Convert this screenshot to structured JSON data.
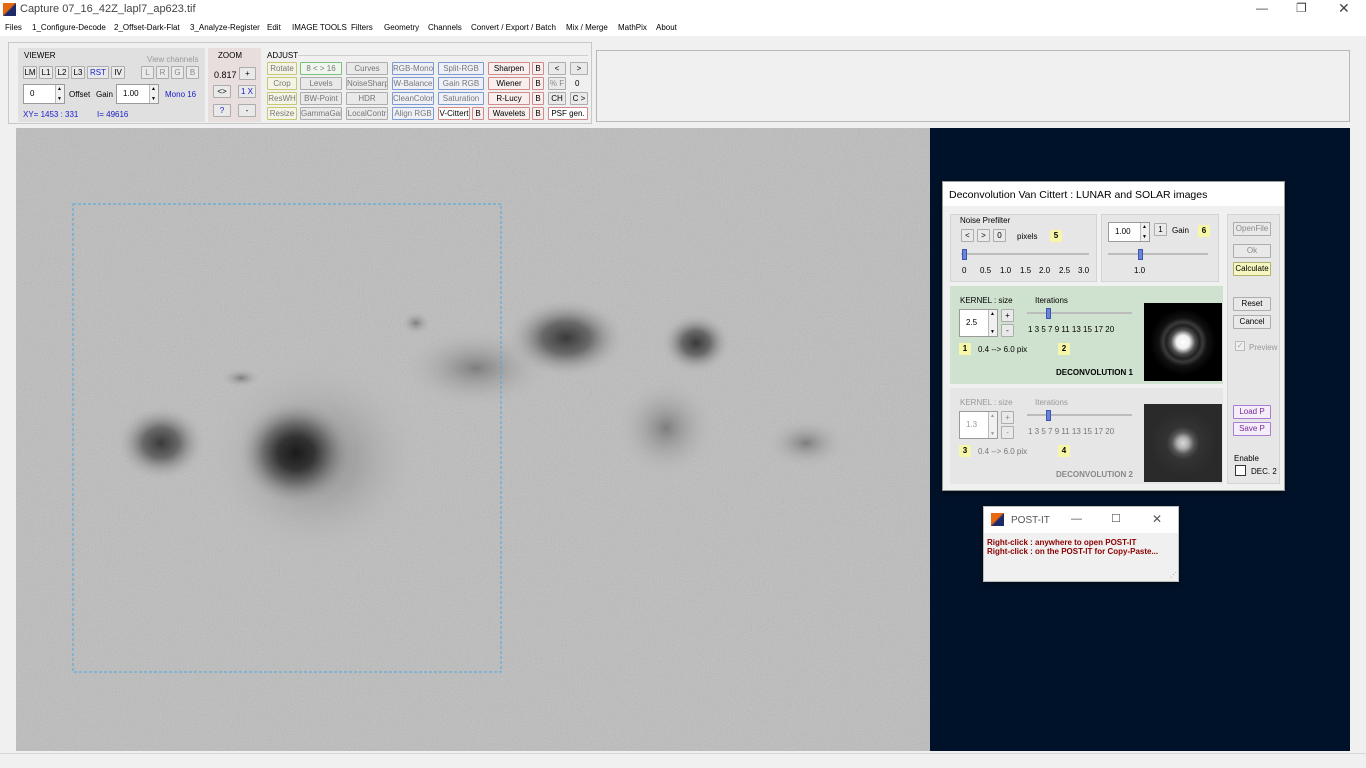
{
  "window": {
    "title": "Capture 07_16_42Z_lapl7_ap623.tif"
  },
  "menu": [
    "Files",
    "1_Configure-Decode",
    "2_Offset-Dark-Flat",
    "3_Analyze-Register",
    "Edit",
    "IMAGE TOOLS",
    "Filters",
    "Geometry",
    "Channels",
    "Convert / Export / Batch",
    "Mix / Merge",
    "MathPix",
    "About"
  ],
  "viewer": {
    "title": "VIEWER",
    "view_channels": "View channels",
    "buttons": [
      "LM",
      "L1",
      "L2",
      "L3",
      "RST",
      "IV"
    ],
    "channels": [
      "L",
      "R",
      "G",
      "B"
    ],
    "offset_value": "0",
    "offset_label": "Offset",
    "gain_label": "Gain",
    "gain_value": "1.00",
    "mono": "Mono 16",
    "xy": "XY=  1453 : 331",
    "intensity": "I=  49616"
  },
  "zoom": {
    "title": "ZOOM",
    "value": "0.817",
    "plus": "+",
    "swap": "<>",
    "onex": "1 X",
    "help": "?",
    "minus": "-"
  },
  "adjust": {
    "title": "ADJUST",
    "col1": [
      "Rotate",
      "Crop",
      "ResWH",
      "Resize"
    ],
    "col2": [
      "8 < > 16",
      "Levels",
      "BW-Point",
      "GammaGain"
    ],
    "col3": [
      "Curves",
      "NoiseSharp",
      "HDR",
      "LocalContr"
    ],
    "col4": [
      "RGB-Mono",
      "W-Balance",
      "CleanColor",
      "Align RGB"
    ],
    "col5": [
      "Split-RGB",
      "Gain RGB",
      "Saturation",
      "V-Cittert"
    ],
    "v_b": "B",
    "col6": [
      "Sharpen",
      "Wiener",
      "R-Lucy",
      "Wavelets"
    ],
    "col6_b": [
      "B",
      "B",
      "B",
      "B"
    ],
    "nav_prev": "<",
    "nav_next": ">",
    "pct_f": "% F",
    "zero": "0",
    "ch": "CH",
    "c_next": "C >",
    "psf": "PSF gen."
  },
  "dialog": {
    "title": "Deconvolution Van Cittert :  LUNAR and SOLAR images",
    "noise": {
      "label": "Noise Prefilter",
      "prev": "<",
      "next": ">",
      "zero": "0",
      "pixels": "pixels",
      "badge": "5",
      "ticks": [
        "0",
        "0.5",
        "1.0",
        "1.5",
        "2.0",
        "2.5",
        "3.0"
      ]
    },
    "gain": {
      "value": "1.00",
      "one": "1",
      "label": "Gain",
      "badge": "6",
      "tick": "1.0"
    },
    "right_buttons": {
      "open": "OpenFile",
      "ok": "Ok",
      "calc": "Calculate",
      "reset": "Reset",
      "cancel": "Cancel",
      "preview": "Preview",
      "load": "Load P",
      "save": "Save P",
      "enable": "Enable",
      "dec2": "DEC. 2"
    },
    "dec1": {
      "kernel": "KERNEL :  size",
      "iter": "Iterations",
      "size": "2.5",
      "plus": "+",
      "minus": "-",
      "ticks": "1 3 5 7 9 11 13 15 17  20",
      "badge1": "1",
      "range": "0.4 --> 6.0 pix",
      "badge2": "2",
      "title": "DECONVOLUTION 1"
    },
    "dec2": {
      "kernel": "KERNEL :  size",
      "iter": "Iterations",
      "size": "1.3",
      "plus": "+",
      "minus": "-",
      "ticks": "1 3 5 7 9 11 13 15 17  20",
      "badge1": "3",
      "range": "0.4 --> 6.0 pix",
      "badge2": "4",
      "title": "DECONVOLUTION 2"
    }
  },
  "postit": {
    "title": "POST-IT",
    "line1": "Right-click : anywhere to open POST-IT",
    "line2": "Right-click : on the POST-IT for Copy-Paste..."
  },
  "colors": {
    "dark_panel": "#001229",
    "dec1_bg": "#cfe2cf",
    "badge": "#f6f6a8",
    "postit_text": "#8b0000"
  }
}
